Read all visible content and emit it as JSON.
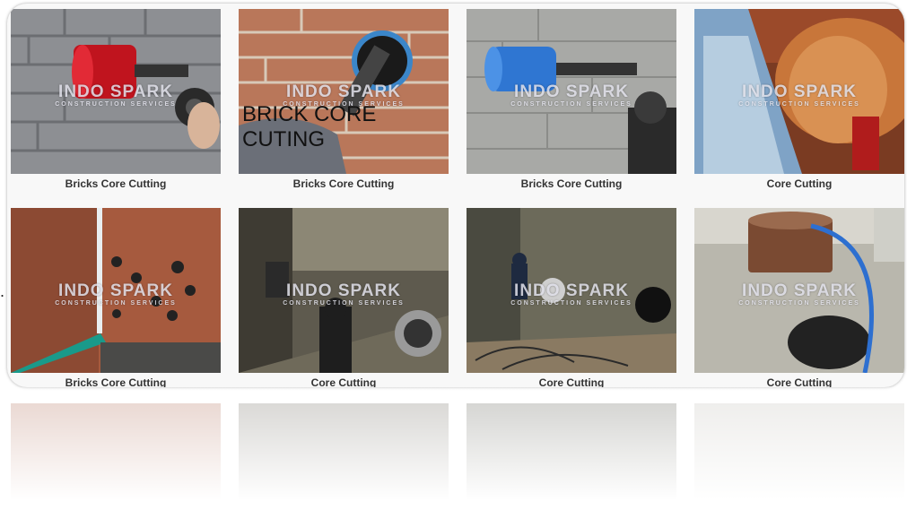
{
  "watermark": {
    "brand": "INDO SPARK",
    "tagline": "CONSTRUCTION SERVICES"
  },
  "photo_overlay_text": {
    "line1": "BRICK CORE",
    "line2": "CUTING"
  },
  "stray_mark": ".",
  "tiles": [
    {
      "caption": "Bricks Core Cutting"
    },
    {
      "caption": "Bricks Core Cutting"
    },
    {
      "caption": "Bricks Core Cutting"
    },
    {
      "caption": "Core Cutting"
    },
    {
      "caption": "Bricks Core Cutting"
    },
    {
      "caption": "Core Cutting"
    },
    {
      "caption": "Core Cutting"
    },
    {
      "caption": "Core Cutting"
    }
  ]
}
